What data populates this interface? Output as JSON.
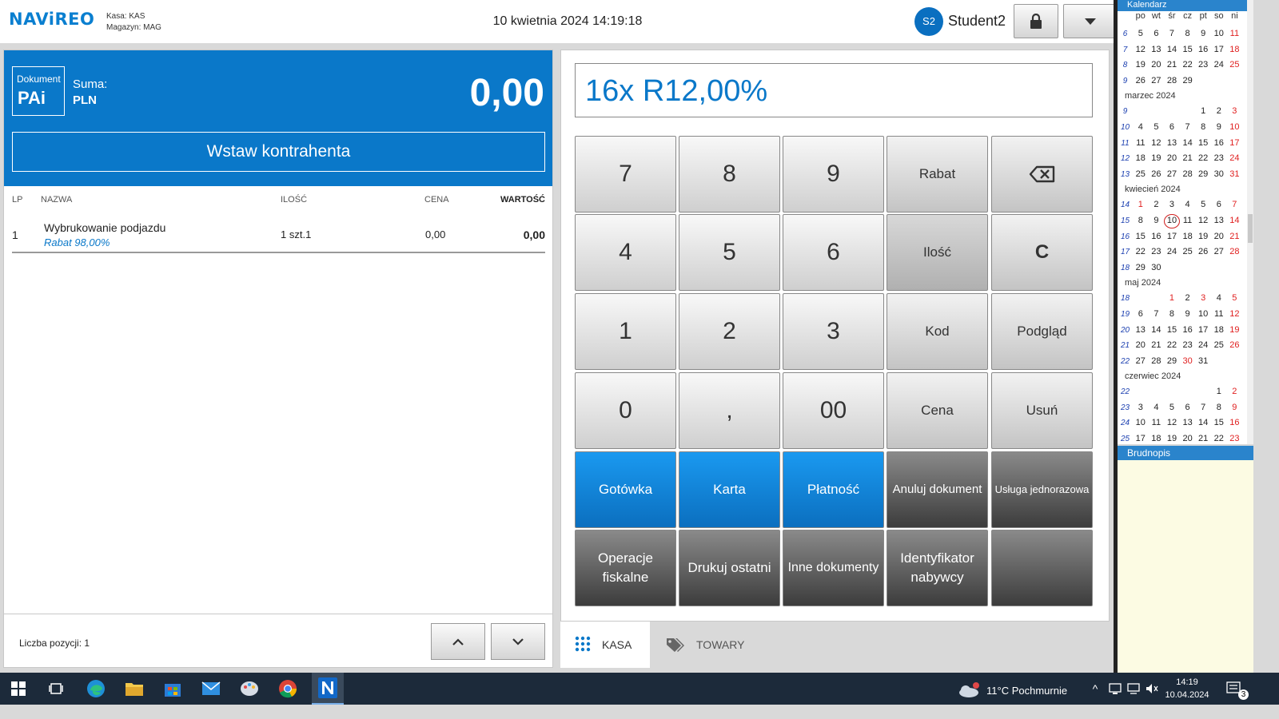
{
  "header": {
    "logo": "NAViREO",
    "kasa_line": "Kasa: KAS",
    "magazyn_line": "Magazyn: MAG",
    "datetime": "10 kwietnia 2024 14:19:18",
    "avatar_initials": "S2",
    "username": "Student2"
  },
  "document": {
    "doc_label": "Dokument",
    "doc_type": "PAi",
    "sum_label": "Suma:",
    "currency": "PLN",
    "total": "0,00",
    "insert_contractor": "Wstaw kontrahenta"
  },
  "table": {
    "columns": [
      "LP",
      "NAZWA",
      "ILOŚĆ",
      "CENA",
      "WARTOŚĆ"
    ],
    "rows": [
      {
        "lp": "1",
        "name": "Wybrukowanie podjazdu",
        "discount": "Rabat 98,00%",
        "qty": "1 szt.1",
        "price": "0,00",
        "value": "0,00"
      }
    ]
  },
  "footer": {
    "item_count": "Liczba pozycji: 1"
  },
  "keypad": {
    "display": "16x R12,00%",
    "keys": {
      "k7": "7",
      "k8": "8",
      "k9": "9",
      "rabat": "Rabat",
      "k4": "4",
      "k5": "5",
      "k6": "6",
      "ilosc": "Ilość",
      "clear": "C",
      "k1": "1",
      "k2": "2",
      "k3": "3",
      "kod": "Kod",
      "podglad": "Podgląd",
      "k0": "0",
      "comma": ",",
      "k00": "00",
      "cena": "Cena",
      "usun": "Usuń",
      "gotowka": "Gotówka",
      "karta": "Karta",
      "platnosc": "Płatność",
      "anuluj": "Anuluj dokument",
      "usluga": "Usługa jednorazowa",
      "operacje": "Operacje fiskalne",
      "drukuj": "Drukuj ostatni",
      "inne": "Inne dokumenty",
      "identyfikator": "Identyfikator nabywcy"
    }
  },
  "tabs": {
    "kasa": "KASA",
    "towary": "TOWARY"
  },
  "calendar": {
    "title": "Kalendarz",
    "weekdays": [
      "po",
      "wt",
      "śr",
      "cz",
      "pt",
      "so",
      "ni"
    ],
    "months": [
      {
        "name": "",
        "weeks": [
          {
            "wk": "6",
            "days": [
              "5",
              "6",
              "7",
              "8",
              "9",
              "10",
              "11"
            ]
          },
          {
            "wk": "7",
            "days": [
              "12",
              "13",
              "14",
              "15",
              "16",
              "17",
              "18"
            ]
          },
          {
            "wk": "8",
            "days": [
              "19",
              "20",
              "21",
              "22",
              "23",
              "24",
              "25"
            ]
          },
          {
            "wk": "9",
            "days": [
              "26",
              "27",
              "28",
              "29",
              "",
              "",
              ""
            ]
          }
        ]
      },
      {
        "name": "marzec 2024",
        "weeks": [
          {
            "wk": "9",
            "days": [
              "",
              "",
              "",
              "",
              "1",
              "2",
              "3"
            ]
          },
          {
            "wk": "10",
            "days": [
              "4",
              "5",
              "6",
              "7",
              "8",
              "9",
              "10"
            ]
          },
          {
            "wk": "11",
            "days": [
              "11",
              "12",
              "13",
              "14",
              "15",
              "16",
              "17"
            ]
          },
          {
            "wk": "12",
            "days": [
              "18",
              "19",
              "20",
              "21",
              "22",
              "23",
              "24"
            ]
          },
          {
            "wk": "13",
            "days": [
              "25",
              "26",
              "27",
              "28",
              "29",
              "30",
              "31"
            ]
          }
        ]
      },
      {
        "name": "kwiecień 2024",
        "weeks": [
          {
            "wk": "14",
            "days": [
              "1",
              "2",
              "3",
              "4",
              "5",
              "6",
              "7"
            ]
          },
          {
            "wk": "15",
            "days": [
              "8",
              "9",
              "10",
              "11",
              "12",
              "13",
              "14"
            ]
          },
          {
            "wk": "16",
            "days": [
              "15",
              "16",
              "17",
              "18",
              "19",
              "20",
              "21"
            ]
          },
          {
            "wk": "17",
            "days": [
              "22",
              "23",
              "24",
              "25",
              "26",
              "27",
              "28"
            ]
          },
          {
            "wk": "18",
            "days": [
              "29",
              "30",
              "",
              "",
              "",
              "",
              ""
            ]
          }
        ]
      },
      {
        "name": "maj 2024",
        "weeks": [
          {
            "wk": "18",
            "days": [
              "",
              "",
              "1",
              "2",
              "3",
              "4",
              "5"
            ]
          },
          {
            "wk": "19",
            "days": [
              "6",
              "7",
              "8",
              "9",
              "10",
              "11",
              "12"
            ]
          },
          {
            "wk": "20",
            "days": [
              "13",
              "14",
              "15",
              "16",
              "17",
              "18",
              "19"
            ]
          },
          {
            "wk": "21",
            "days": [
              "20",
              "21",
              "22",
              "23",
              "24",
              "25",
              "26"
            ]
          },
          {
            "wk": "22",
            "days": [
              "27",
              "28",
              "29",
              "30",
              "31",
              "",
              ""
            ]
          }
        ]
      },
      {
        "name": "czerwiec 2024",
        "weeks": [
          {
            "wk": "22",
            "days": [
              "",
              "",
              "",
              "",
              "",
              "1",
              "2"
            ]
          },
          {
            "wk": "23",
            "days": [
              "3",
              "4",
              "5",
              "6",
              "7",
              "8",
              "9"
            ]
          },
          {
            "wk": "24",
            "days": [
              "10",
              "11",
              "12",
              "13",
              "14",
              "15",
              "16"
            ]
          },
          {
            "wk": "25",
            "days": [
              "17",
              "18",
              "19",
              "20",
              "21",
              "22",
              "23"
            ]
          }
        ]
      }
    ],
    "today": "10",
    "red_days": [
      "1",
      "30"
    ],
    "notepad_title": "Brudnopis"
  },
  "taskbar": {
    "weather": "11°C Pochmurnie",
    "time": "14:19",
    "date": "10.04.2024",
    "notification_count": "3",
    "weather_badge": "1"
  },
  "colors": {
    "accent_blue": "#0a78c9",
    "dark_key": "#3c3c3c",
    "calendar_red": "#e02020"
  }
}
